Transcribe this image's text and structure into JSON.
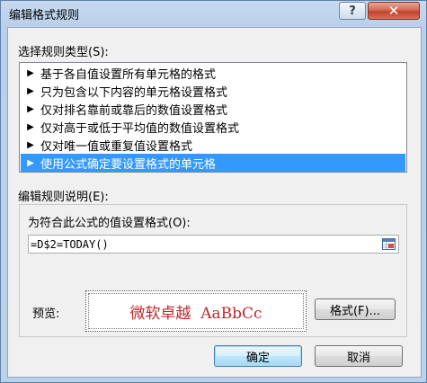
{
  "window": {
    "title": "编辑格式规则"
  },
  "titlebar": {
    "help_label": "?",
    "close_label": "✕"
  },
  "rule_type": {
    "label": "选择规则类型(S):",
    "items": [
      {
        "label": "基于各自值设置所有单元格的格式",
        "selected": false
      },
      {
        "label": "只为包含以下内容的单元格设置格式",
        "selected": false
      },
      {
        "label": "仅对排名靠前或靠后的数值设置格式",
        "selected": false
      },
      {
        "label": "仅对高于或低于平均值的数值设置格式",
        "selected": false
      },
      {
        "label": "仅对唯一值或重复值设置格式",
        "selected": false
      },
      {
        "label": "使用公式确定要设置格式的单元格",
        "selected": true
      }
    ]
  },
  "description": {
    "label": "编辑规则说明(E):",
    "formula_label": "为符合此公式的值设置格式(O):",
    "formula_value": "=D$2=TODAY()",
    "preview_label": "预览:",
    "preview_text": "微软卓越  AaBbCc",
    "format_button": "格式(F)..."
  },
  "buttons": {
    "ok": "确定",
    "cancel": "取消"
  },
  "colors": {
    "selection": "#3399ff",
    "preview_text": "#c0282a"
  }
}
